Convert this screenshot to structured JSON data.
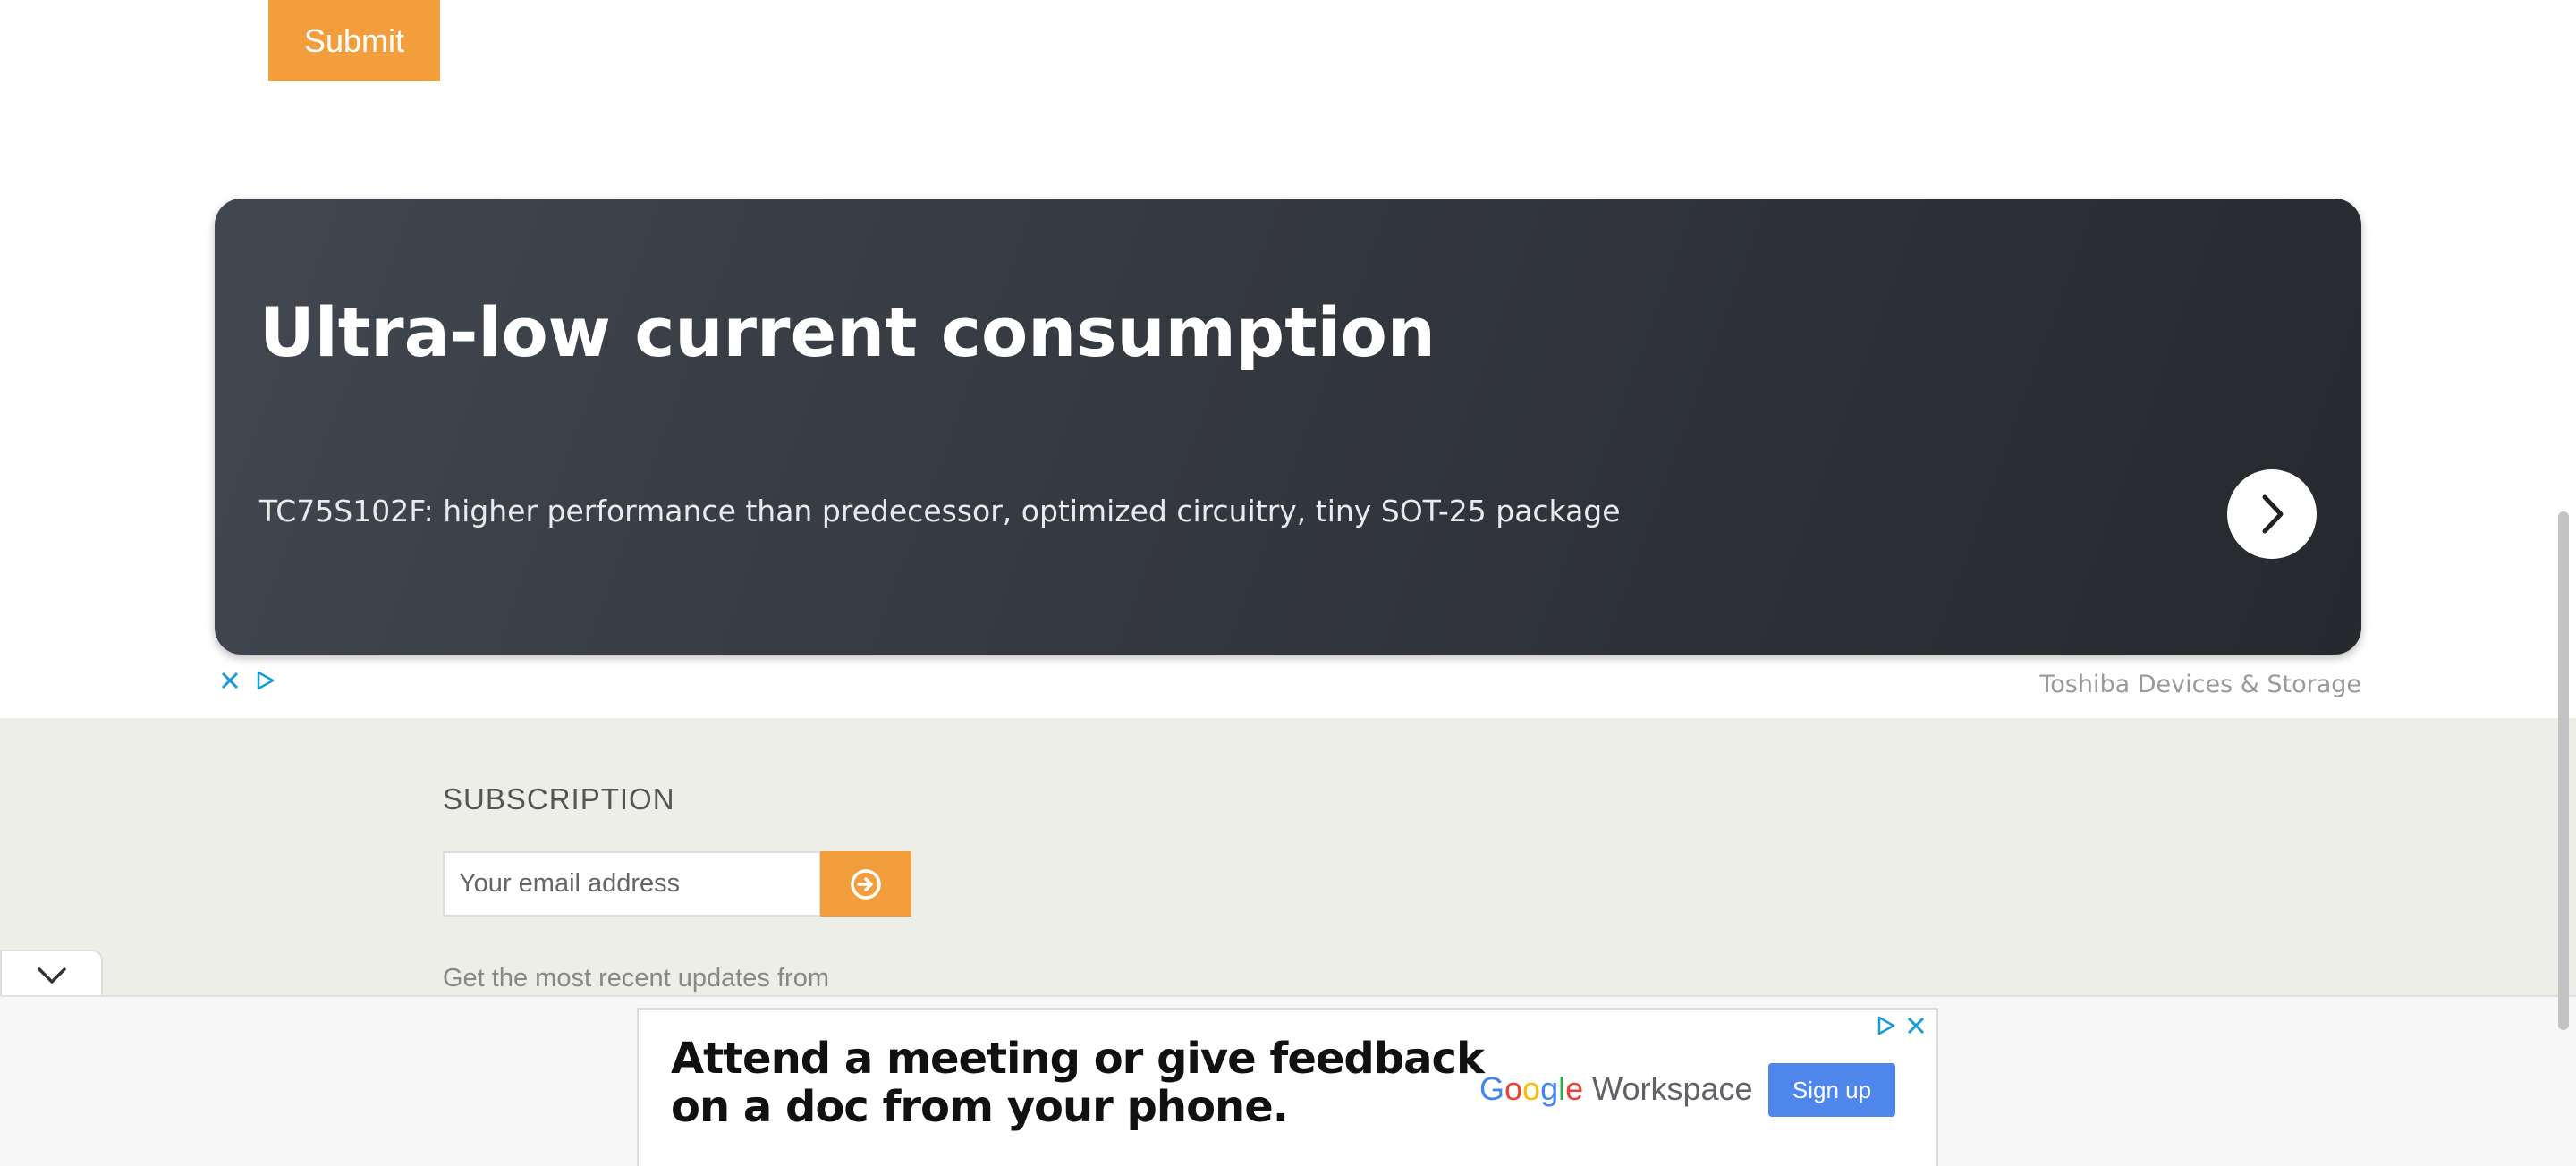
{
  "form": {
    "submit_label": "Submit"
  },
  "ad_banner": {
    "title": "Ultra-low current consumption",
    "subtitle": "TC75S102F: higher performance than predecessor, optimized circuitry, tiny SOT-25 package",
    "advertiser": "Toshiba Devices & Storage",
    "arrow_icon": "chevron-right-icon",
    "controls": [
      "close-icon",
      "adchoices-icon"
    ]
  },
  "subscription": {
    "title": "SUBSCRIPTION",
    "email_placeholder": "Your email address",
    "submit_icon": "arrow-circle-right-icon",
    "description": "Get the most recent updates from"
  },
  "collapse_tab": {
    "icon": "chevron-down-icon"
  },
  "bottom_ad": {
    "headline_line1": "Attend a meeting or give feedback",
    "headline_line2": "on a doc from your phone.",
    "brand_google": "Google",
    "brand_workspace": "Workspace",
    "cta_label": "Sign up",
    "controls": [
      "adchoices-icon",
      "close-icon"
    ]
  },
  "colors": {
    "accent": "#f29e3d",
    "banner_bg": "#34383f",
    "section_bg": "#eeeee8",
    "cta_blue": "#4f86ec"
  }
}
